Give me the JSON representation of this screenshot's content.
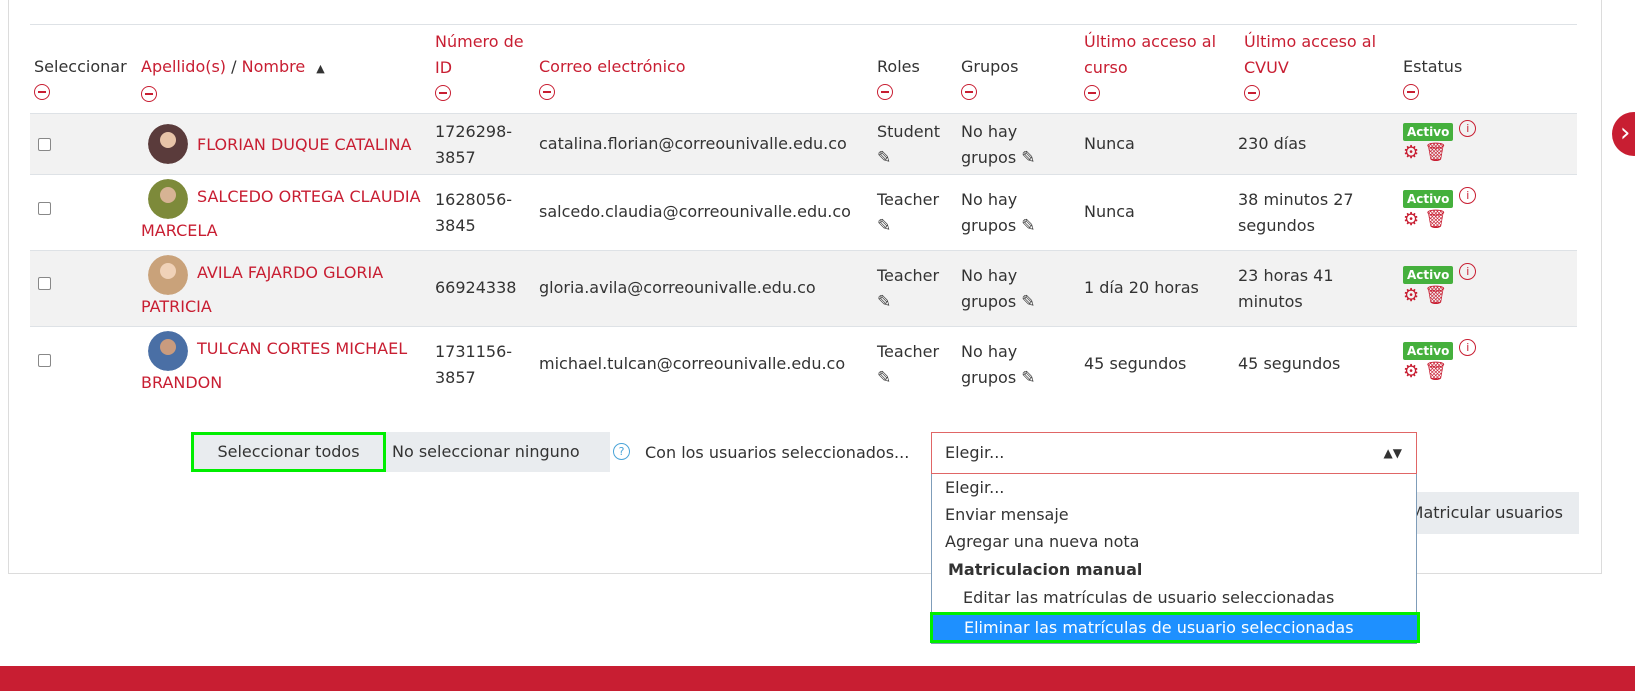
{
  "table": {
    "headers": {
      "select": "Seleccionar",
      "surname": "Apellido(s)",
      "slash": " / ",
      "name": "Nombre",
      "sort_icon": "▲",
      "id_line1": "Número de",
      "id_line2": "ID",
      "email": "Correo electrónico",
      "roles": "Roles",
      "groups": "Grupos",
      "last_course_line1": "Último acceso al",
      "last_course_line2": "curso",
      "last_site_line1": "Último acceso al",
      "last_site_line2": "CVUV",
      "status": "Estatus"
    },
    "rows": [
      {
        "name_line1": "FLORIAN DUQUE CATALINA",
        "name_line2": "",
        "id_line1": "1726298-",
        "id_line2": "3857",
        "email": "catalina.florian@correounivalle.edu.co",
        "role": "Student",
        "groups_line1": "No hay",
        "groups_line2": "grupos",
        "last_course": "Nunca",
        "last_site_line1": "230 días",
        "last_site_line2": "",
        "status": "Activo",
        "avatar_color": "#5a3b3b"
      },
      {
        "name_line1": "SALCEDO ORTEGA CLAUDIA",
        "name_line2": "MARCELA",
        "id_line1": "1628056-",
        "id_line2": "3845",
        "email": "salcedo.claudia@correounivalle.edu.co",
        "role": "Teacher",
        "groups_line1": "No hay",
        "groups_line2": "grupos",
        "last_course": "Nunca",
        "last_site_line1": "38 minutos 27",
        "last_site_line2": "segundos",
        "status": "Activo",
        "avatar_color": "#7d8a3a"
      },
      {
        "name_line1": "AVILA FAJARDO GLORIA",
        "name_line2": "PATRICIA",
        "id_line1": "66924338",
        "id_line2": "",
        "email": "gloria.avila@correounivalle.edu.co",
        "role": "Teacher",
        "groups_line1": "No hay",
        "groups_line2": "grupos",
        "last_course": "1 día 20 horas",
        "last_site_line1": "23 horas 41",
        "last_site_line2": "minutos",
        "status": "Activo",
        "avatar_color": "#c9a27a"
      },
      {
        "name_line1": "TULCAN CORTES MICHAEL",
        "name_line2": "BRANDON",
        "id_line1": "1731156-",
        "id_line2": "3857",
        "email": "michael.tulcan@correounivalle.edu.co",
        "role": "Teacher",
        "groups_line1": "No hay",
        "groups_line2": "grupos",
        "last_course": "45 segundos",
        "last_site_line1": "45 segundos",
        "last_site_line2": "",
        "status": "Activo",
        "avatar_color": "#4a6fa5"
      }
    ]
  },
  "bulk": {
    "select_all": "Seleccionar todos",
    "select_none": "No seleccionar ninguno",
    "with_selected": "Con los usuarios seleccionados...",
    "select_value": "Elegir...",
    "options": [
      "Elegir...",
      "Enviar mensaje",
      "Agregar una nueva nota"
    ],
    "group_label": "Matriculacion manual",
    "group_options": [
      "Editar las matrículas de usuario seleccionadas",
      "Eliminar las matrículas de usuario seleccionadas"
    ],
    "enrol_button": "Matricular usuarios"
  },
  "colors": {
    "accent": "#c81e32",
    "active_badge": "#45b03d",
    "highlight": "#00ee00",
    "selected_option": "#1e90ff"
  },
  "icons": {
    "next": "chevron-right-icon",
    "collapse": "minus-circle-icon",
    "edit": "pencil-icon",
    "info": "info-icon",
    "settings": "gear-icon",
    "delete": "trash-icon",
    "help": "question-circle-icon"
  }
}
